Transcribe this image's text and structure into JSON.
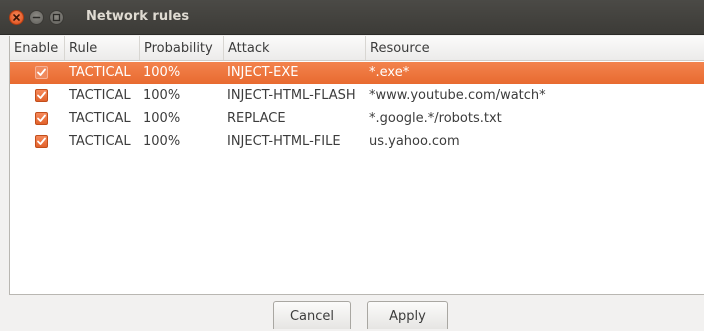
{
  "window": {
    "title": "Network rules"
  },
  "table": {
    "columns": [
      "Enable",
      "Rule",
      "Probability",
      "Attack",
      "Resource"
    ],
    "rows": [
      {
        "enabled": true,
        "rule": "TACTICAL",
        "probability": "100%",
        "attack": "INJECT-EXE",
        "resource": "*.exe*",
        "selected": true
      },
      {
        "enabled": true,
        "rule": "TACTICAL",
        "probability": "100%",
        "attack": "INJECT-HTML-FLASH",
        "resource": "*www.youtube.com/watch*",
        "selected": false
      },
      {
        "enabled": true,
        "rule": "TACTICAL",
        "probability": "100%",
        "attack": "REPLACE",
        "resource": "*.google.*/robots.txt",
        "selected": false
      },
      {
        "enabled": true,
        "rule": "TACTICAL",
        "probability": "100%",
        "attack": "INJECT-HTML-FILE",
        "resource": "us.yahoo.com",
        "selected": false
      }
    ]
  },
  "buttons": {
    "cancel": "Cancel",
    "apply": "Apply"
  },
  "colors": {
    "selection": "#e86a30",
    "checkbox": "#e2622c",
    "titlebar": "#3c3b37"
  },
  "icons": [
    "close-icon",
    "minimize-icon",
    "maximize-icon",
    "checkmark-icon"
  ]
}
